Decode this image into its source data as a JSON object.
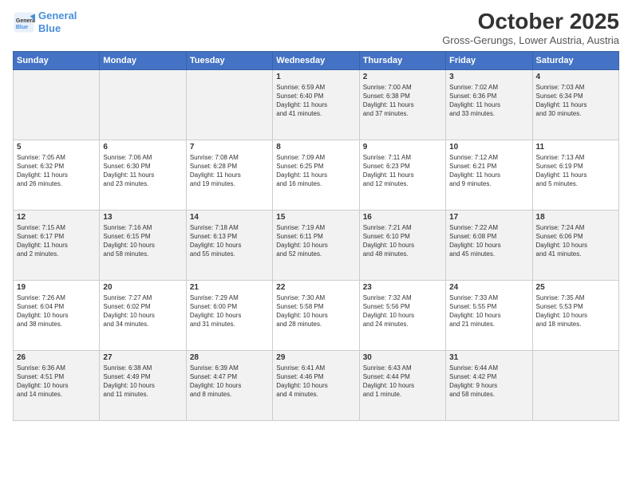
{
  "logo": {
    "line1": "General",
    "line2": "Blue"
  },
  "title": "October 2025",
  "subtitle": "Gross-Gerungs, Lower Austria, Austria",
  "days_of_week": [
    "Sunday",
    "Monday",
    "Tuesday",
    "Wednesday",
    "Thursday",
    "Friday",
    "Saturday"
  ],
  "weeks": [
    [
      {
        "day": "",
        "info": ""
      },
      {
        "day": "",
        "info": ""
      },
      {
        "day": "",
        "info": ""
      },
      {
        "day": "1",
        "info": "Sunrise: 6:59 AM\nSunset: 6:40 PM\nDaylight: 11 hours\nand 41 minutes."
      },
      {
        "day": "2",
        "info": "Sunrise: 7:00 AM\nSunset: 6:38 PM\nDaylight: 11 hours\nand 37 minutes."
      },
      {
        "day": "3",
        "info": "Sunrise: 7:02 AM\nSunset: 6:36 PM\nDaylight: 11 hours\nand 33 minutes."
      },
      {
        "day": "4",
        "info": "Sunrise: 7:03 AM\nSunset: 6:34 PM\nDaylight: 11 hours\nand 30 minutes."
      }
    ],
    [
      {
        "day": "5",
        "info": "Sunrise: 7:05 AM\nSunset: 6:32 PM\nDaylight: 11 hours\nand 26 minutes."
      },
      {
        "day": "6",
        "info": "Sunrise: 7:06 AM\nSunset: 6:30 PM\nDaylight: 11 hours\nand 23 minutes."
      },
      {
        "day": "7",
        "info": "Sunrise: 7:08 AM\nSunset: 6:28 PM\nDaylight: 11 hours\nand 19 minutes."
      },
      {
        "day": "8",
        "info": "Sunrise: 7:09 AM\nSunset: 6:25 PM\nDaylight: 11 hours\nand 16 minutes."
      },
      {
        "day": "9",
        "info": "Sunrise: 7:11 AM\nSunset: 6:23 PM\nDaylight: 11 hours\nand 12 minutes."
      },
      {
        "day": "10",
        "info": "Sunrise: 7:12 AM\nSunset: 6:21 PM\nDaylight: 11 hours\nand 9 minutes."
      },
      {
        "day": "11",
        "info": "Sunrise: 7:13 AM\nSunset: 6:19 PM\nDaylight: 11 hours\nand 5 minutes."
      }
    ],
    [
      {
        "day": "12",
        "info": "Sunrise: 7:15 AM\nSunset: 6:17 PM\nDaylight: 11 hours\nand 2 minutes."
      },
      {
        "day": "13",
        "info": "Sunrise: 7:16 AM\nSunset: 6:15 PM\nDaylight: 10 hours\nand 58 minutes."
      },
      {
        "day": "14",
        "info": "Sunrise: 7:18 AM\nSunset: 6:13 PM\nDaylight: 10 hours\nand 55 minutes."
      },
      {
        "day": "15",
        "info": "Sunrise: 7:19 AM\nSunset: 6:11 PM\nDaylight: 10 hours\nand 52 minutes."
      },
      {
        "day": "16",
        "info": "Sunrise: 7:21 AM\nSunset: 6:10 PM\nDaylight: 10 hours\nand 48 minutes."
      },
      {
        "day": "17",
        "info": "Sunrise: 7:22 AM\nSunset: 6:08 PM\nDaylight: 10 hours\nand 45 minutes."
      },
      {
        "day": "18",
        "info": "Sunrise: 7:24 AM\nSunset: 6:06 PM\nDaylight: 10 hours\nand 41 minutes."
      }
    ],
    [
      {
        "day": "19",
        "info": "Sunrise: 7:26 AM\nSunset: 6:04 PM\nDaylight: 10 hours\nand 38 minutes."
      },
      {
        "day": "20",
        "info": "Sunrise: 7:27 AM\nSunset: 6:02 PM\nDaylight: 10 hours\nand 34 minutes."
      },
      {
        "day": "21",
        "info": "Sunrise: 7:29 AM\nSunset: 6:00 PM\nDaylight: 10 hours\nand 31 minutes."
      },
      {
        "day": "22",
        "info": "Sunrise: 7:30 AM\nSunset: 5:58 PM\nDaylight: 10 hours\nand 28 minutes."
      },
      {
        "day": "23",
        "info": "Sunrise: 7:32 AM\nSunset: 5:56 PM\nDaylight: 10 hours\nand 24 minutes."
      },
      {
        "day": "24",
        "info": "Sunrise: 7:33 AM\nSunset: 5:55 PM\nDaylight: 10 hours\nand 21 minutes."
      },
      {
        "day": "25",
        "info": "Sunrise: 7:35 AM\nSunset: 5:53 PM\nDaylight: 10 hours\nand 18 minutes."
      }
    ],
    [
      {
        "day": "26",
        "info": "Sunrise: 6:36 AM\nSunset: 4:51 PM\nDaylight: 10 hours\nand 14 minutes."
      },
      {
        "day": "27",
        "info": "Sunrise: 6:38 AM\nSunset: 4:49 PM\nDaylight: 10 hours\nand 11 minutes."
      },
      {
        "day": "28",
        "info": "Sunrise: 6:39 AM\nSunset: 4:47 PM\nDaylight: 10 hours\nand 8 minutes."
      },
      {
        "day": "29",
        "info": "Sunrise: 6:41 AM\nSunset: 4:46 PM\nDaylight: 10 hours\nand 4 minutes."
      },
      {
        "day": "30",
        "info": "Sunrise: 6:43 AM\nSunset: 4:44 PM\nDaylight: 10 hours\nand 1 minute."
      },
      {
        "day": "31",
        "info": "Sunrise: 6:44 AM\nSunset: 4:42 PM\nDaylight: 9 hours\nand 58 minutes."
      },
      {
        "day": "",
        "info": ""
      }
    ]
  ]
}
